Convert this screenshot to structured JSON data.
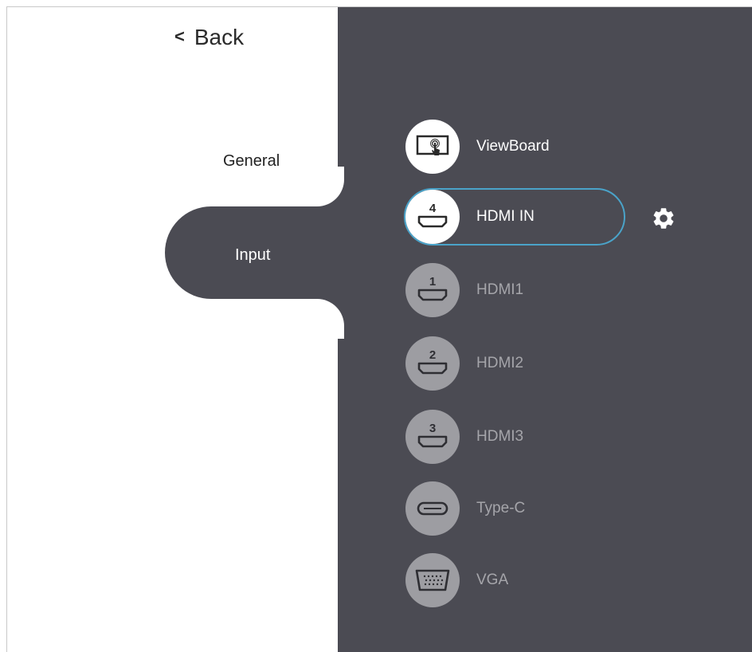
{
  "nav": {
    "back_label": "Back",
    "items": [
      {
        "label": "General",
        "selected": false
      },
      {
        "label": "Input",
        "selected": true
      }
    ]
  },
  "sources": [
    {
      "label": "ViewBoard",
      "icon": "touchscreen-icon",
      "number": "",
      "state": "active"
    },
    {
      "label": "HDMI IN",
      "icon": "hdmi-port-icon",
      "number": "4",
      "state": "selected"
    },
    {
      "label": "HDMI1",
      "icon": "hdmi-port-icon",
      "number": "1",
      "state": "inactive"
    },
    {
      "label": "HDMI2",
      "icon": "hdmi-port-icon",
      "number": "2",
      "state": "inactive"
    },
    {
      "label": "HDMI3",
      "icon": "hdmi-port-icon",
      "number": "3",
      "state": "inactive"
    },
    {
      "label": "Type-C",
      "icon": "usb-c-port-icon",
      "number": "",
      "state": "inactive"
    },
    {
      "label": "VGA",
      "icon": "vga-port-icon",
      "number": "",
      "state": "inactive"
    }
  ],
  "settings_icon": "gear-icon",
  "colors": {
    "panel_dark": "#4b4b53",
    "selection_outline": "#4aa3c9",
    "inactive_icon_bg": "#9d9da2"
  }
}
